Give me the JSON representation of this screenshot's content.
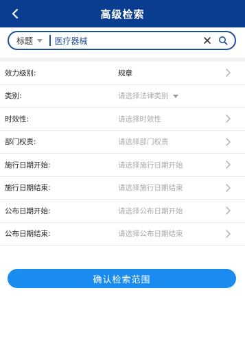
{
  "header": {
    "title": "高级检索"
  },
  "search": {
    "field": "标题",
    "value": "医疗器械"
  },
  "filters": [
    {
      "label": "效力级别:",
      "value": "规章",
      "placeholder": false
    },
    {
      "label": "类别:",
      "value": "请选择法律类别",
      "placeholder": true
    },
    {
      "label": "时效性:",
      "value": "请选择时效性",
      "placeholder": true
    },
    {
      "label": "部门权责:",
      "value": "请选择部门权责",
      "placeholder": true
    },
    {
      "label": "施行日期开始:",
      "value": "请选择施行日期开始",
      "placeholder": true
    },
    {
      "label": "施行日期结束:",
      "value": "请选择施行日期结束",
      "placeholder": true
    },
    {
      "label": "公布日期开始:",
      "value": "请选择公布日期开始",
      "placeholder": true
    },
    {
      "label": "公布日期结束:",
      "value": "请选择公布日期结束",
      "placeholder": true
    }
  ],
  "confirm": {
    "label": "确认检索范围"
  },
  "colors": {
    "header": "#0a3d8f",
    "accent": "#1a8cf0",
    "search_border": "#1f4e9c",
    "placeholder": "#a9a9a9"
  },
  "icons": {
    "back": "chevron-left-icon",
    "field_dropdown": "caret-down-icon",
    "clear": "close-icon",
    "search": "search-icon",
    "row": "chevron-right-icon"
  }
}
